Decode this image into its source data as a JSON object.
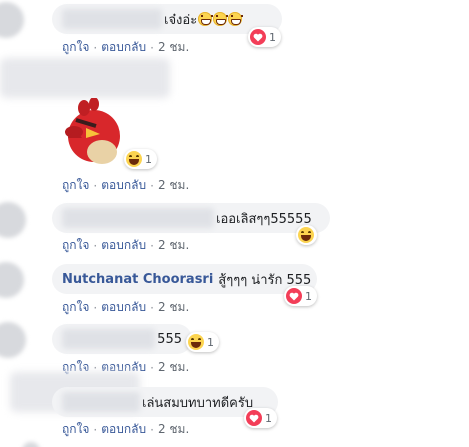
{
  "comments": [
    {
      "text": "เจ๋งอ่ะ",
      "emoji": [
        "grinning-face",
        "grinning-face",
        "grinning-face"
      ],
      "reaction": {
        "type": "love",
        "count": "1"
      },
      "actions": {
        "like": "ถูกใจ",
        "reply": "ตอบกลับ",
        "time": "2 ชม."
      }
    },
    {
      "sticker": "red-bird-sticker",
      "reaction": {
        "type": "haha",
        "count": "1"
      },
      "actions": {
        "like": "ถูกใจ",
        "reply": "ตอบกลับ",
        "time": "2 ชม."
      }
    },
    {
      "text": "เออเลิสๆๆ55555",
      "reaction": {
        "type": "haha",
        "count": ""
      },
      "actions": {
        "like": "ถูกใจ",
        "reply": "ตอบกลับ",
        "time": "2 ชม."
      }
    },
    {
      "author": "Nutchanat Choorasri",
      "text": "สู้ๆๆๆ น่ารัก 555",
      "reaction": {
        "type": "love",
        "count": "1"
      },
      "actions": {
        "like": "ถูกใจ",
        "reply": "ตอบกลับ",
        "time": "2 ชม."
      }
    },
    {
      "text": "555",
      "reaction": {
        "type": "haha",
        "count": "1"
      },
      "actions": {
        "like": "ถูกใจ",
        "reply": "ตอบกลับ",
        "time": "2 ชม."
      }
    },
    {
      "text": "เล่นสมบทบาทดีครับ",
      "reaction": {
        "type": "love",
        "count": "1"
      },
      "actions": {
        "like": "ถูกใจ",
        "reply": "ตอบกลับ",
        "time": "2 ชม."
      }
    }
  ],
  "colors": {
    "link": "#385898",
    "meta": "#606770",
    "bubble": "#f2f3f5",
    "love": "#f33e58",
    "haha": "#fcd450"
  }
}
